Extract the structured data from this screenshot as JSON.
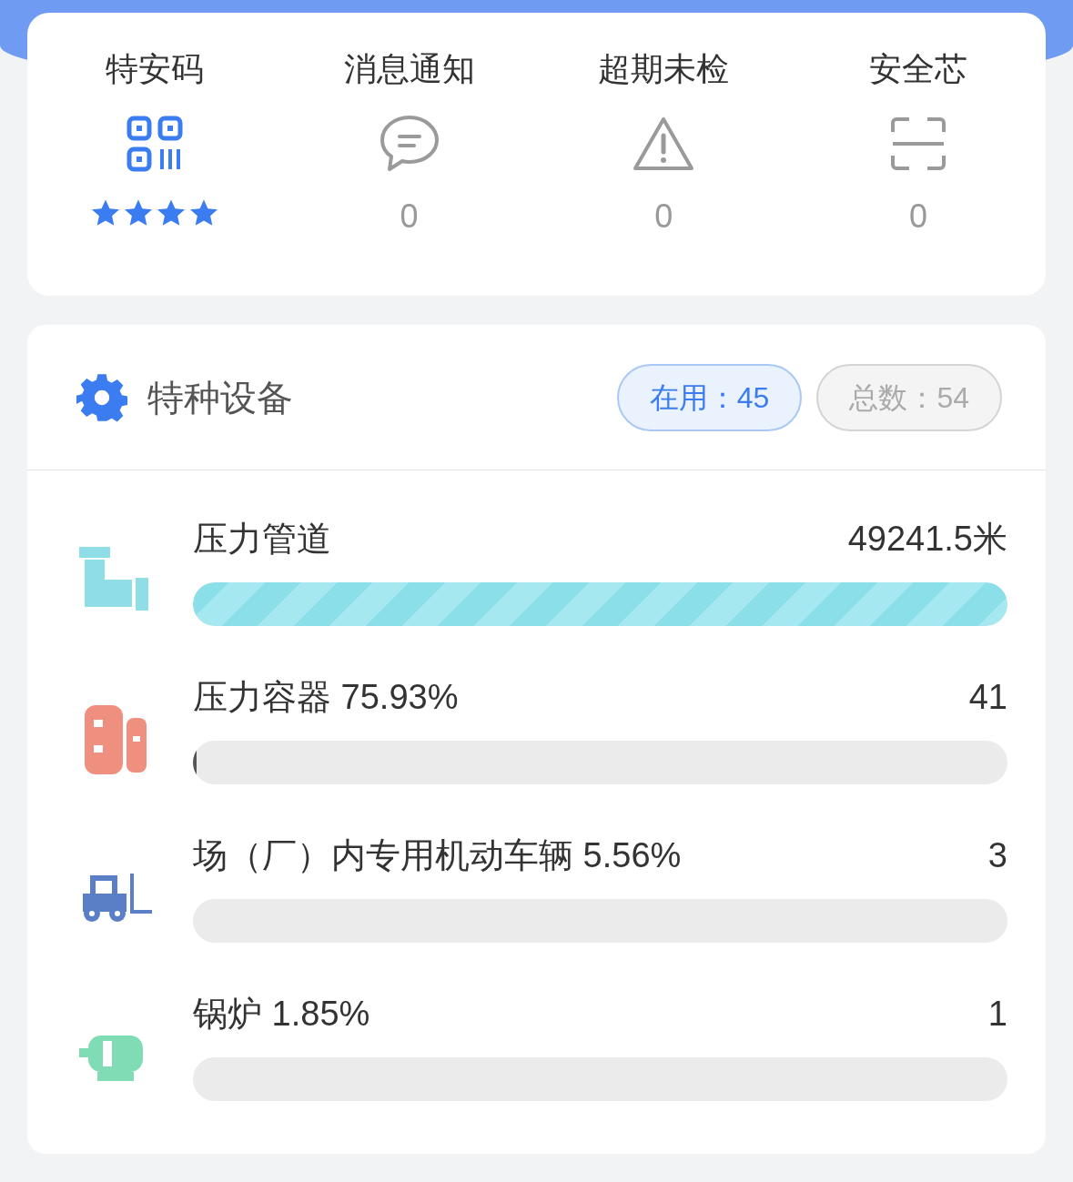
{
  "quick_links": [
    {
      "label": "特安码",
      "kind": "stars",
      "stars": 4
    },
    {
      "label": "消息通知",
      "kind": "count",
      "count": "0"
    },
    {
      "label": "超期未检",
      "kind": "count",
      "count": "0"
    },
    {
      "label": "安全芯",
      "kind": "count",
      "count": "0"
    }
  ],
  "equipment": {
    "title": "特种设备",
    "in_use": "在用：45",
    "total": "总数：54",
    "items": [
      {
        "label": "压力管道",
        "value": "49241.5米",
        "level": 1,
        "kind": "pipe"
      },
      {
        "label": "压力容器 75.93%",
        "value": "41",
        "level": 0.004,
        "kind": "vessel"
      },
      {
        "label": "场（厂）内专用机动车辆 5.56%",
        "value": "3",
        "level": 0,
        "kind": "forklift"
      },
      {
        "label": "锅炉 1.85%",
        "value": "1",
        "level": 0,
        "kind": "boiler"
      }
    ]
  }
}
